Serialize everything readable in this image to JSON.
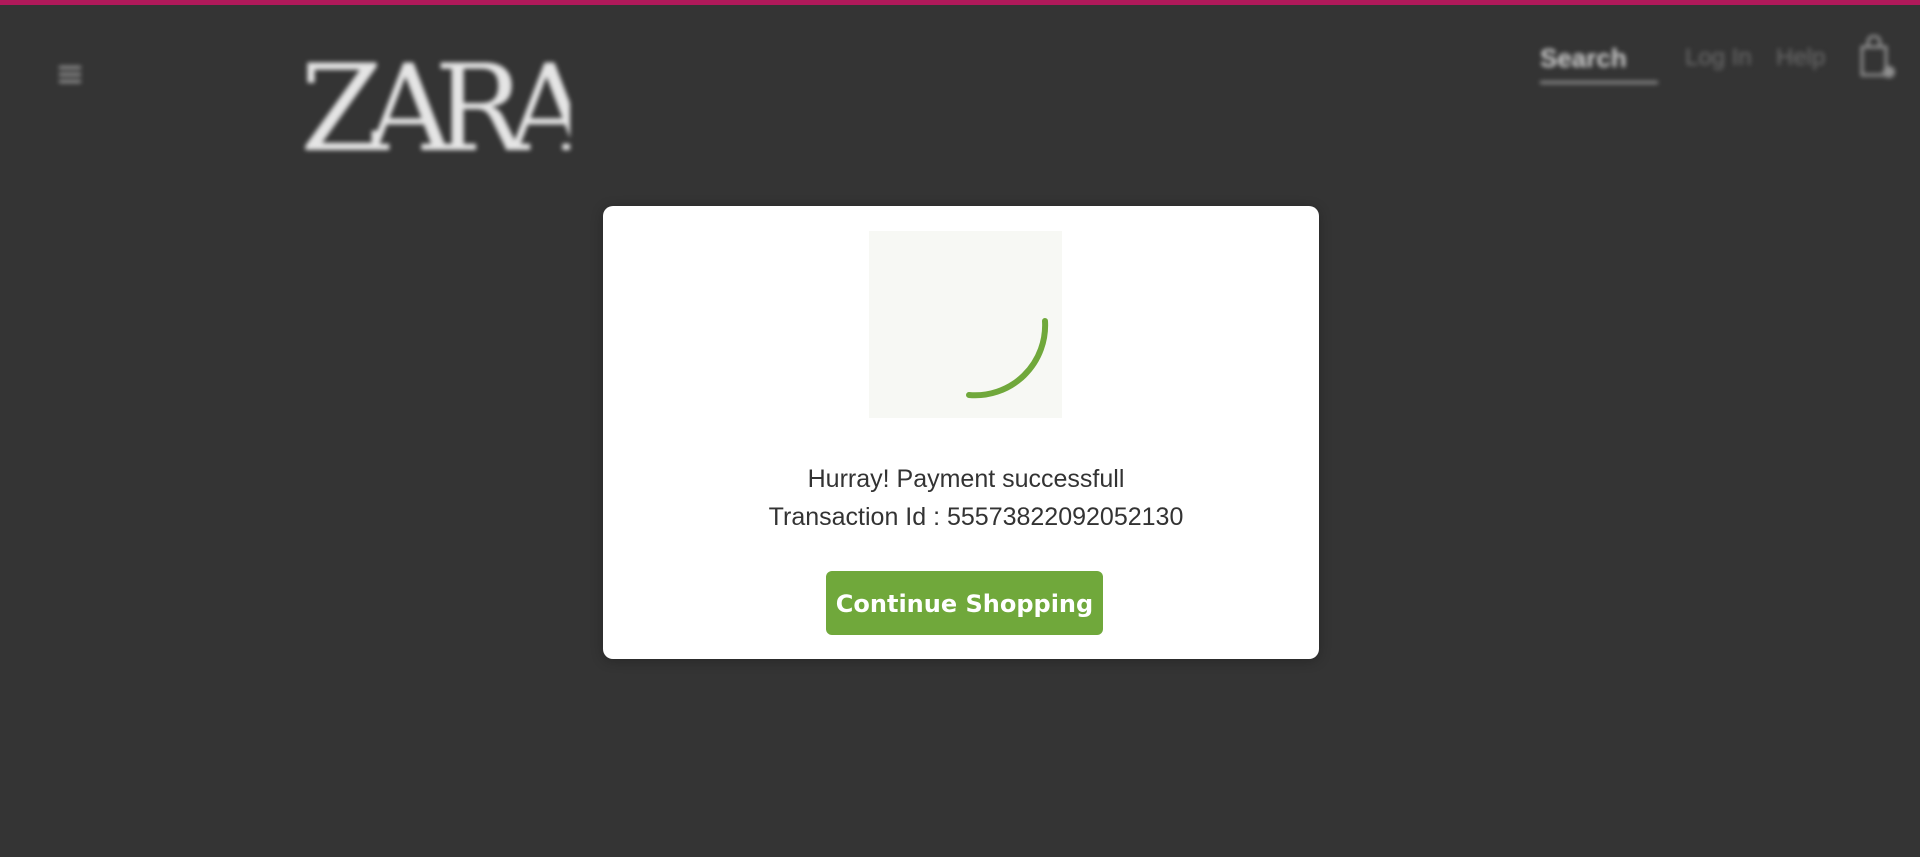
{
  "header": {
    "logo_text": "ZARA",
    "search_label": "Search",
    "login_label": "Log In",
    "help_label": "Help",
    "menu_icon": "menu-icon",
    "bag_icon": "shopping-bag-icon"
  },
  "modal": {
    "message": "Hurray! Payment successfull",
    "transaction_line": "Transaction Id : 55573822092052130",
    "continue_label": "Continue Shopping",
    "status_icon": "loading-spinner-icon"
  },
  "colors": {
    "accent_bar": "#b0195a",
    "success_green": "#70a83b",
    "overlay_bg": "#343434",
    "modal_bg": "#ffffff"
  }
}
